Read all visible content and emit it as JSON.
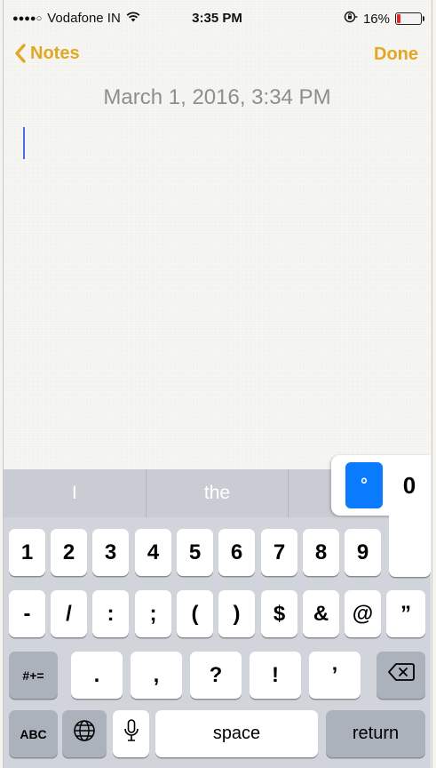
{
  "status_bar": {
    "signal_dots": "●●●●○",
    "carrier": "Vodafone IN",
    "wifi_icon": "wifi-icon",
    "time": "3:35 PM",
    "orientation_lock_icon": "orientation-lock-icon",
    "battery_percent": "16%",
    "battery_level": 0.16,
    "battery_color": "#e8262a"
  },
  "nav": {
    "back_label": "Notes",
    "done_label": "Done",
    "accent_color": "#e2a723"
  },
  "note": {
    "timestamp": "March 1, 2016, 3:34 PM",
    "body": ""
  },
  "keyboard": {
    "predictions": [
      "I",
      "the",
      ""
    ],
    "row1": [
      "1",
      "2",
      "3",
      "4",
      "5",
      "6",
      "7",
      "8",
      "9"
    ],
    "row2": [
      "-",
      "/",
      ":",
      ";",
      "(",
      ")",
      "$",
      "&",
      "@",
      "”"
    ],
    "row3": [
      ".",
      ",",
      "?",
      "!",
      "’"
    ],
    "symbols_label": "#+=",
    "abc_label": "ABC",
    "space_label": "space",
    "return_label": "return",
    "popup": {
      "selected": "°",
      "alternate": "0"
    }
  }
}
